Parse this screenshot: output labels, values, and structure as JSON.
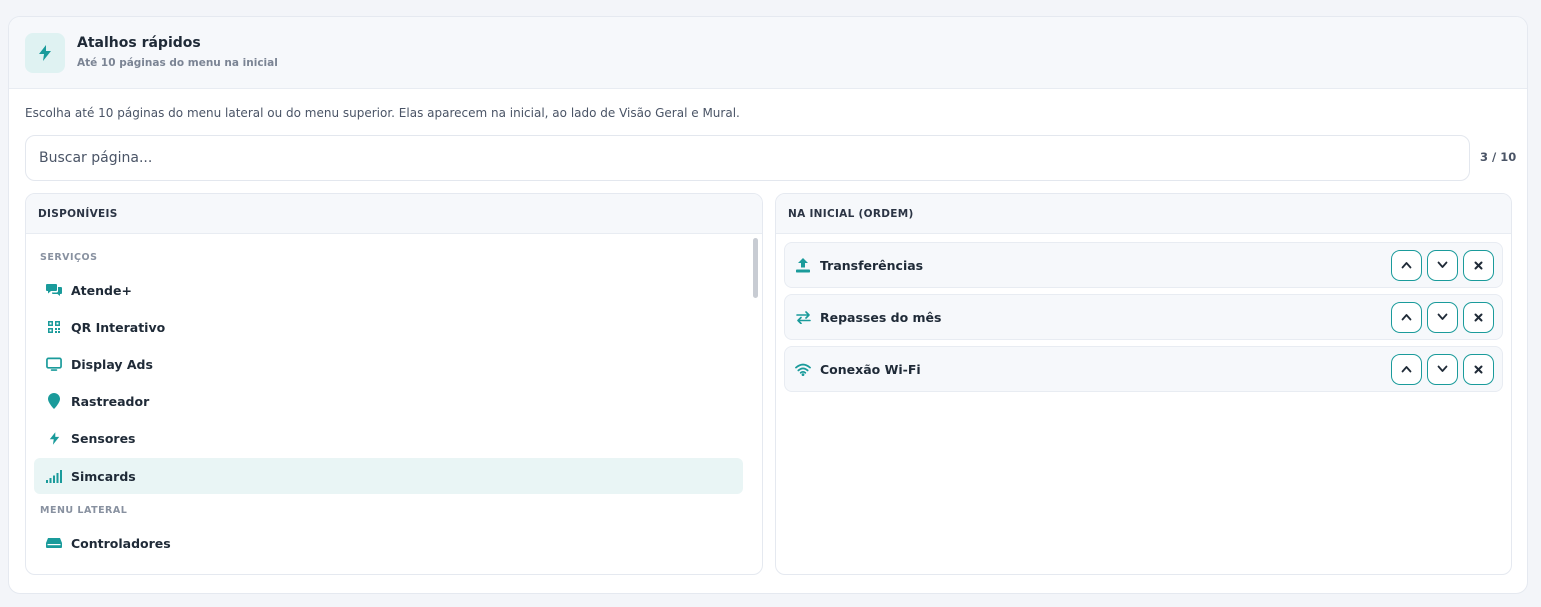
{
  "header": {
    "title": "Atalhos rápidos",
    "subtitle": "Até 10 páginas do menu na inicial",
    "icon": "bolt-icon"
  },
  "description": "Escolha até 10 páginas do menu lateral ou do menu superior. Elas aparecem na inicial, ao lado de Visão Geral e Mural.",
  "search": {
    "placeholder": "Buscar página...",
    "value": ""
  },
  "counter": "3 / 10",
  "available": {
    "title": "DISPONÍVEIS",
    "groups": [
      {
        "label": "SERVIÇOS",
        "items": [
          {
            "label": "Atende+",
            "icon": "chat-icon"
          },
          {
            "label": "QR Interativo",
            "icon": "qr-icon"
          },
          {
            "label": "Display Ads",
            "icon": "monitor-icon"
          },
          {
            "label": "Rastreador",
            "icon": "location-pin-icon"
          },
          {
            "label": "Sensores",
            "icon": "bolt-icon"
          },
          {
            "label": "Simcards",
            "icon": "signal-icon"
          }
        ]
      },
      {
        "label": "MENU LATERAL",
        "items": [
          {
            "label": "Controladores",
            "icon": "server-icon"
          }
        ]
      }
    ]
  },
  "selected": {
    "title": "NA INICIAL (ORDEM)",
    "items": [
      {
        "label": "Transferências",
        "icon": "upload-icon"
      },
      {
        "label": "Repasses do mês",
        "icon": "swap-icon"
      },
      {
        "label": "Conexão Wi-Fi",
        "icon": "wifi-icon"
      }
    ]
  },
  "colors": {
    "accent": "#1a9b9b",
    "icon_bg": "#dff2f2",
    "active_row": "#e9f5f5"
  }
}
